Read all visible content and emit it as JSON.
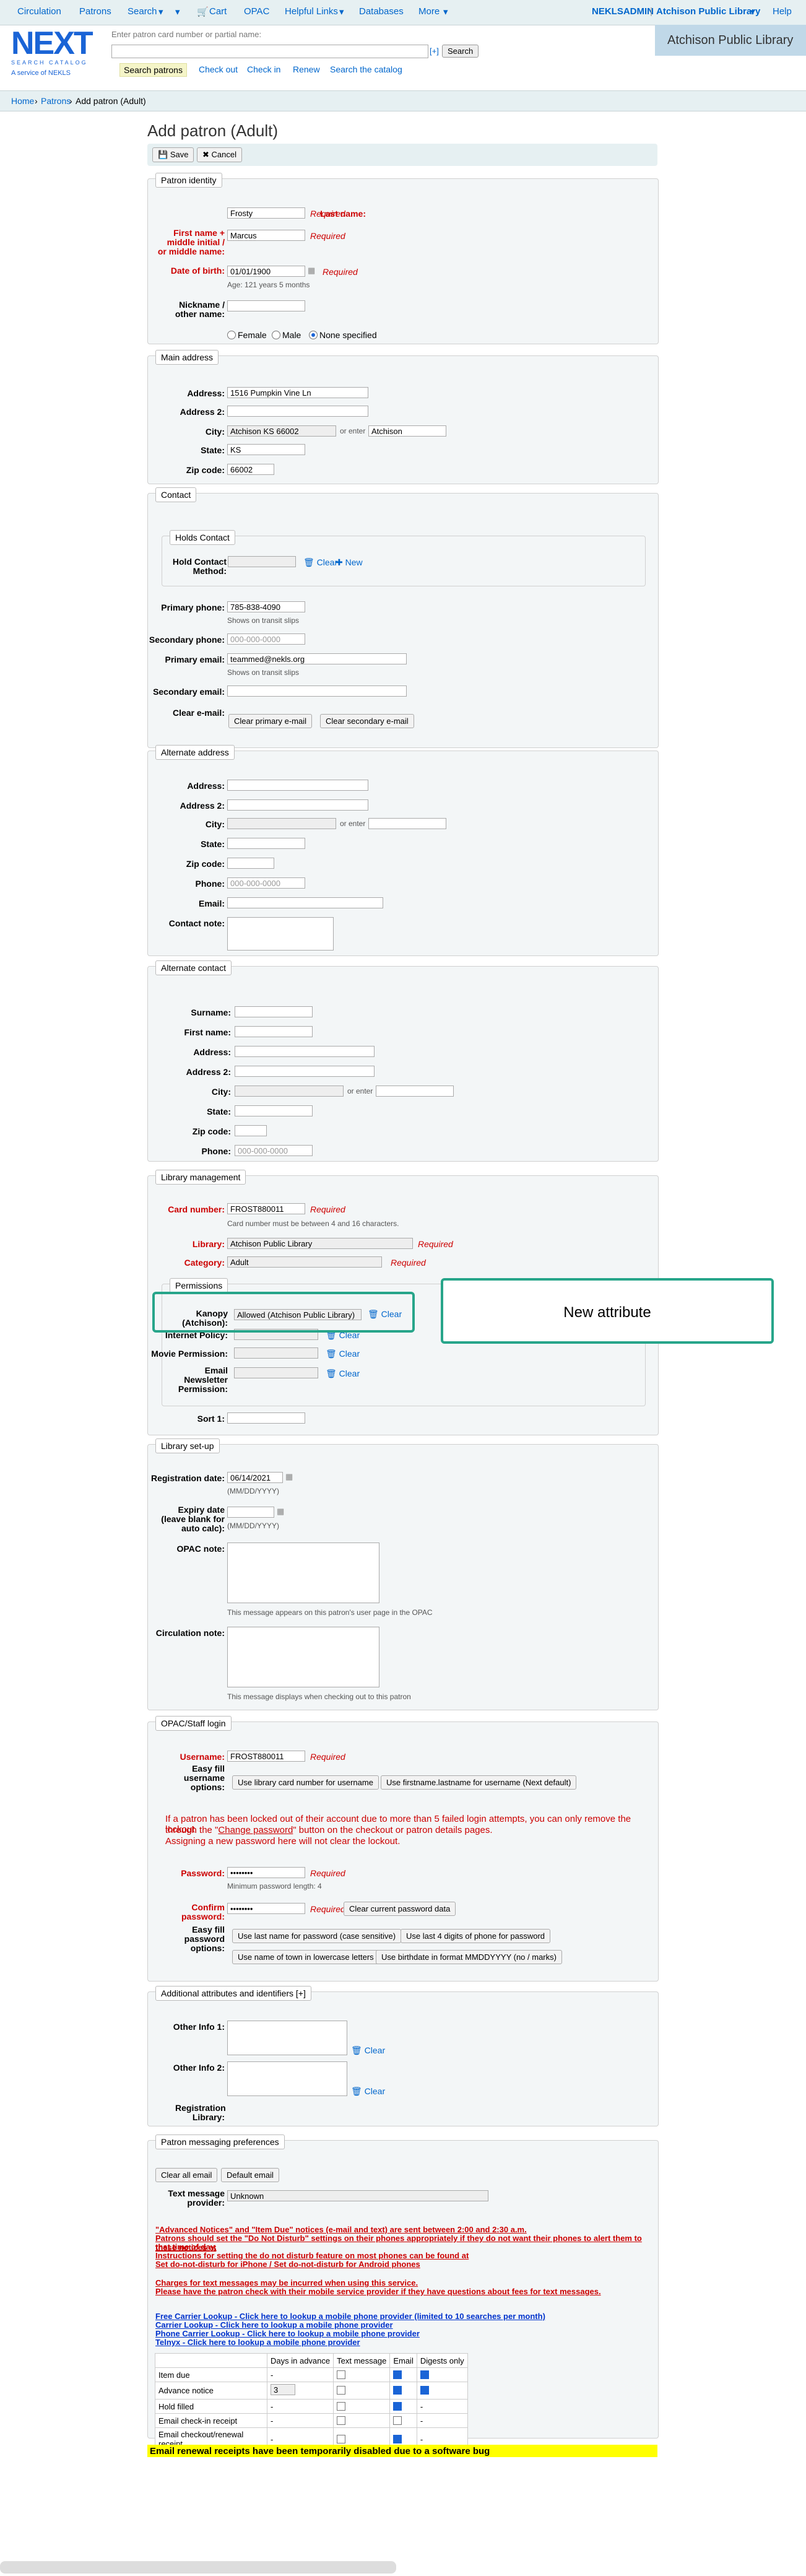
{
  "topnav": {
    "circulation": "Circulation",
    "patrons": "Patrons",
    "search": "Search",
    "cart": "Cart",
    "opac": "OPAC",
    "helpful_links": "Helpful Links",
    "databases": "Databases",
    "more": "More",
    "user": "NEKLSADMIN",
    "library_menu": "Atchison Public Library",
    "help": "Help"
  },
  "header": {
    "logo_text": "NEXT",
    "logo_sub": "SEARCH CATALOG",
    "service": "A service of NEKLS",
    "search_placeholder": "Enter patron card number or partial name:",
    "plus": "[+]",
    "search_button": "Search",
    "library_name": "Atchison Public Library"
  },
  "tabs": [
    "Search patrons",
    "Check out",
    "Check in",
    "Renew",
    "Search the catalog"
  ],
  "breadcrumb": {
    "home": "Home",
    "patrons": "Patrons",
    "current": "Add patron (Adult)",
    "sep": "›"
  },
  "page_title": "Add patron (Adult)",
  "toolbar": {
    "save": "Save",
    "cancel": "Cancel"
  },
  "common": {
    "required": "Required",
    "clear": "Clear",
    "new": "New"
  },
  "identity": {
    "legend": "Patron identity",
    "last_name_label": "Last name:",
    "last_name_value": "Frosty",
    "first_name_label": "First name + middle initial / or middle name:",
    "first_name_value": "Marcus",
    "dob_label": "Date of birth:",
    "dob_value": "01/01/1900",
    "age_hint": "Age: 121 years 5 months",
    "nickname_label": "Nickname / other name:",
    "gender_female": "Female",
    "gender_male": "Male",
    "gender_none": "None specified"
  },
  "main_address": {
    "legend": "Main address",
    "address_label": "Address:",
    "address_value": "1516 Pumpkin Vine Ln",
    "address2_label": "Address 2:",
    "city_label": "City:",
    "city_value": "Atchison KS 66002",
    "or_enter": "or enter",
    "city_text": "Atchison",
    "state_label": "State:",
    "state_value": "KS",
    "zip_label": "Zip code:",
    "zip_value": "66002"
  },
  "contact": {
    "legend": "Contact",
    "holds_legend": "Holds Contact",
    "hold_method_label": "Hold Contact Method:",
    "primary_phone_label": "Primary phone:",
    "primary_phone_value": "785-838-4090",
    "shows_slips": "Shows on transit slips",
    "secondary_phone_label": "Secondary phone:",
    "phone_placeholder": "000-000-0000",
    "primary_email_label": "Primary email:",
    "primary_email_value": "teammed@nekls.org",
    "secondary_email_label": "Secondary email:",
    "clear_email_label": "Clear e-mail:",
    "clear_primary": "Clear primary e-mail",
    "clear_secondary": "Clear secondary e-mail"
  },
  "alt_address": {
    "legend": "Alternate address",
    "address_label": "Address:",
    "address2_label": "Address 2:",
    "city_label": "City:",
    "or_enter": "or enter",
    "state_label": "State:",
    "zip_label": "Zip code:",
    "phone_label": "Phone:",
    "phone_placeholder": "000-000-0000",
    "email_label": "Email:",
    "note_label": "Contact note:"
  },
  "alt_contact": {
    "legend": "Alternate contact",
    "surname_label": "Surname:",
    "first_label": "First name:",
    "address_label": "Address:",
    "address2_label": "Address 2:",
    "city_label": "City:",
    "or_enter": "or enter",
    "state_label": "State:",
    "zip_label": "Zip code:",
    "phone_label": "Phone:",
    "phone_placeholder": "000-000-0000"
  },
  "library_mgmt": {
    "legend": "Library management",
    "card_label": "Card number:",
    "card_value": "FROST880011",
    "card_hint": "Card number must be between 4 and 16 characters.",
    "library_label": "Library:",
    "library_value": "Atchison Public Library",
    "category_label": "Category:",
    "category_value": "Adult",
    "permissions_legend": "Permissions",
    "kanopy_label": "Kanopy (Atchison):",
    "kanopy_value": "Allowed (Atchison Public Library)",
    "internet_label": "Internet Policy:",
    "movie_label": "Movie Permission:",
    "newsletter_label": "Email Newsletter Permission:",
    "sort1_label": "Sort 1:",
    "callout": "New attribute"
  },
  "library_setup": {
    "legend": "Library set-up",
    "reg_label": "Registration date:",
    "reg_value": "06/14/2021",
    "date_format": "(MM/DD/YYYY)",
    "expiry_label": "Expiry date (leave blank for auto calc):",
    "opac_note_label": "OPAC note:",
    "opac_note_hint": "This message appears on this patron's user page in the OPAC",
    "circ_note_label": "Circulation note:",
    "circ_note_hint": "This message displays when checking out to this patron"
  },
  "opac_login": {
    "legend": "OPAC/Staff login",
    "username_label": "Username:",
    "username_value": "FROST880011",
    "easy_username_label": "Easy fill username options:",
    "use_card": "Use library card number for username",
    "use_name": "Use firstname.lastname for username (Next default)",
    "warning_1": "If a patron has been locked out of their account due to more than 5 failed login attempts, you can only remove the lockout",
    "warning_2a": "through the \"",
    "warning_link": "Change password",
    "warning_2b": "\" button on the checkout or patron details pages.",
    "warning_3": "Assigning a new password here will not clear the lockout.",
    "password_label": "Password:",
    "password_value": "••••••••",
    "min_length": "Minimum password length: 4",
    "confirm_label": "Confirm password:",
    "confirm_value": "••••••••",
    "clear_password": "Clear current password data",
    "easy_password_label": "Easy fill password options:",
    "use_last_name": "Use last name for password (case sensitive)",
    "use_last4": "Use last 4 digits of phone for password",
    "use_town": "Use name of town in lowercase letters",
    "use_birthdate": "Use birthdate in format MMDDYYYY (no / marks)"
  },
  "additional": {
    "legend": "Additional attributes and identifiers [+]",
    "other1_label": "Other Info 1:",
    "other2_label": "Other Info 2:",
    "reg_library_label": "Registration Library:"
  },
  "messaging": {
    "legend": "Patron messaging preferences",
    "clear_all": "Clear all email",
    "default_email": "Default email",
    "text_provider_label": "Text message provider:",
    "text_provider_value": "Unknown",
    "red_lines": [
      "\"Advanced Notices\" and \"Item Due\" notices (e-mail and text) are sent between 2:00 and 2:30 a.m.",
      "Patrons should set the \"Do Not Disturb\" settings on their phones appropriately if they do not want their phones to alert them to these notices at",
      "that time of day.",
      "Instructions for setting the do not disturb feature on most phones can be found at",
      "Set do-not-disturb for iPhone / Set do-not-disturb for Android phones"
    ],
    "red_lines_2": [
      "Charges for text messages may be incurred when using this service.",
      "Please have the patron check with their mobile service provider if they have questions about fees for text messages."
    ],
    "blue_links": [
      "Free Carrier Lookup - Click here to lookup a mobile phone provider (limited to 10 searches per month)",
      "Carrier Lookup - Click here to lookup a mobile phone provider",
      "Phone Carrier Lookup - Click here to lookup a mobile phone provider",
      "Telnyx - Click here to lookup a mobile phone provider"
    ],
    "table_headers": [
      "",
      "Days in advance",
      "Text message",
      "Email",
      "Digests only"
    ],
    "table_rows": [
      {
        "name": "Item due",
        "days": "-",
        "text": false,
        "email": true,
        "digest": true
      },
      {
        "name": "Advance notice",
        "days": "3",
        "text": false,
        "email": true,
        "digest": true
      },
      {
        "name": "Hold filled",
        "days": "-",
        "text": false,
        "email": true,
        "digest": "-"
      },
      {
        "name": "Email check-in receipt",
        "days": "-",
        "text": false,
        "email": false,
        "digest": "-"
      },
      {
        "name": "Email checkout/renewal receipt",
        "days": "-",
        "text": false,
        "email": true,
        "digest": "-"
      }
    ],
    "banner": "Email renewal receipts have been temporarily disabled due to a software bug"
  },
  "colors": {
    "link": "#0066cc",
    "required": "#cc0000",
    "callout_border": "#27a58a",
    "banner": "#ffff00"
  }
}
